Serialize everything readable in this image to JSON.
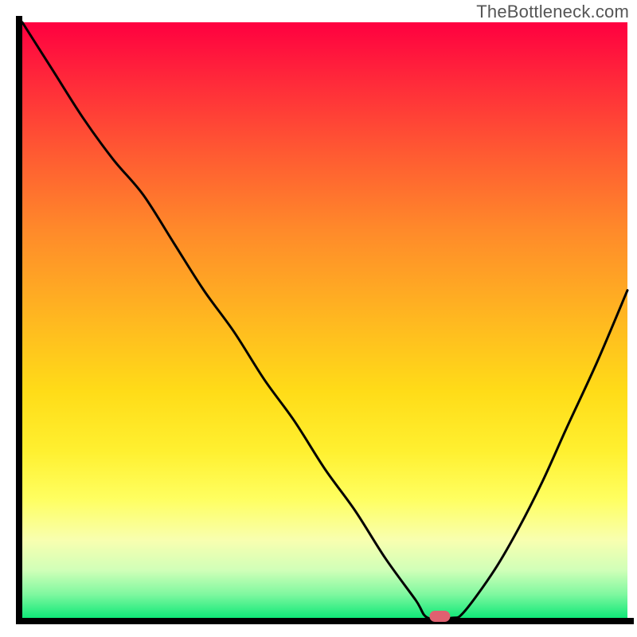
{
  "watermark": "TheBottleneck.com",
  "chart_data": {
    "type": "line",
    "title": "",
    "xlabel": "",
    "ylabel": "",
    "xlim": [
      0,
      100
    ],
    "ylim": [
      0,
      100
    ],
    "x": [
      0,
      5,
      10,
      15,
      20,
      25,
      30,
      35,
      40,
      45,
      50,
      55,
      60,
      65,
      67,
      71,
      73,
      78,
      82,
      86,
      90,
      95,
      100
    ],
    "values": [
      100,
      92,
      84,
      77,
      71,
      63,
      55,
      48,
      40,
      33,
      25,
      18,
      10,
      3,
      0,
      0,
      1,
      8,
      15,
      23,
      32,
      43,
      55
    ],
    "marker": {
      "x": 69,
      "y": 0
    },
    "gradient_stops": [
      {
        "pos": 0.0,
        "color": "#ff0040"
      },
      {
        "pos": 0.1,
        "color": "#ff2a3a"
      },
      {
        "pos": 0.22,
        "color": "#ff5a32"
      },
      {
        "pos": 0.35,
        "color": "#ff8a2a"
      },
      {
        "pos": 0.5,
        "color": "#ffb820"
      },
      {
        "pos": 0.62,
        "color": "#ffdc18"
      },
      {
        "pos": 0.72,
        "color": "#fff030"
      },
      {
        "pos": 0.8,
        "color": "#ffff60"
      },
      {
        "pos": 0.87,
        "color": "#f8ffb0"
      },
      {
        "pos": 0.92,
        "color": "#d0ffb8"
      },
      {
        "pos": 0.96,
        "color": "#80f8a0"
      },
      {
        "pos": 1.0,
        "color": "#10e878"
      }
    ],
    "marker_color": "#e06070",
    "axis_color": "#000000"
  }
}
